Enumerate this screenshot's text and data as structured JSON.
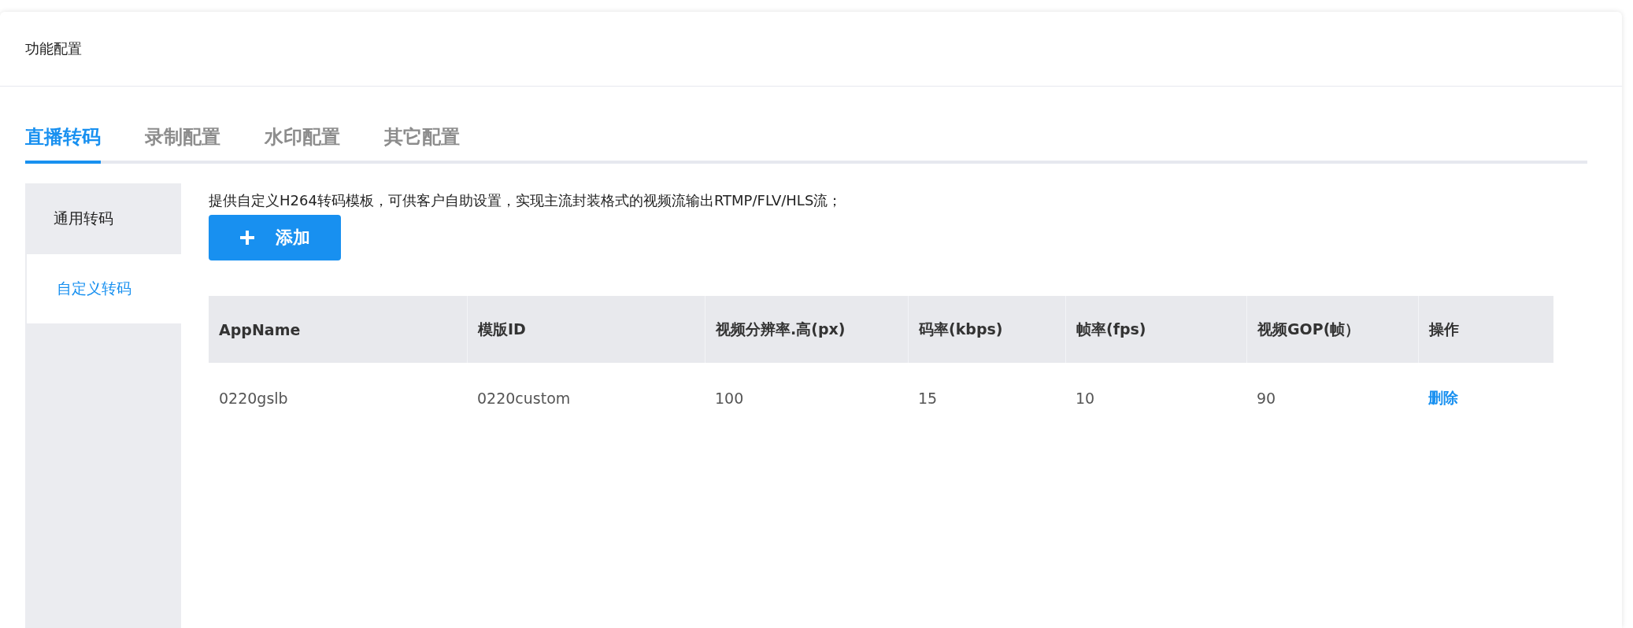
{
  "header": {
    "title": "功能配置"
  },
  "tabs": [
    {
      "label": "直播转码",
      "selected": true
    },
    {
      "label": "录制配置",
      "selected": false
    },
    {
      "label": "水印配置",
      "selected": false
    },
    {
      "label": "其它配置",
      "selected": false
    }
  ],
  "sidebar": {
    "items": [
      {
        "label": "通用转码",
        "selected": false
      },
      {
        "label": "自定义转码",
        "selected": true
      }
    ]
  },
  "description": "提供自定义H264转码模板，可供客户自助设置，实现主流封装格式的视频流输出RTMP/FLV/HLS流；",
  "add_button": {
    "label": "添加"
  },
  "table": {
    "columns": [
      "AppName",
      "模版ID",
      "视频分辨率.高(px)",
      "码率(kbps)",
      "帧率(fps)",
      "视频GOP(帧）",
      "操作"
    ],
    "rows": [
      {
        "cells": [
          "0220gslb",
          "0220custom",
          "100",
          "15",
          "10",
          "90"
        ],
        "action": "删除"
      }
    ]
  }
}
